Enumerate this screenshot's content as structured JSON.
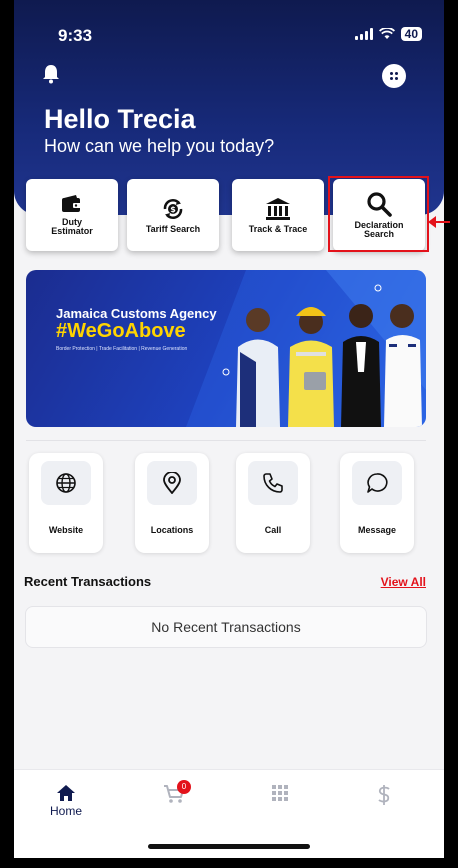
{
  "status_bar": {
    "time": "9:33",
    "battery": "40"
  },
  "header": {
    "greeting": "Hello Trecia",
    "subtitle": "How can we help you today?"
  },
  "quick_actions": [
    {
      "label": "Duty Estimator",
      "icon": "wallet-icon"
    },
    {
      "label": "Tariff Search",
      "icon": "dollar-cycle-icon"
    },
    {
      "label": "Track & Trace",
      "icon": "bank-building-icon"
    },
    {
      "label": "Declaration Search",
      "icon": "search-icon",
      "highlighted": true
    }
  ],
  "banner": {
    "title": "Jamaica Customs Agency",
    "tagline": "#WeGoAbove",
    "subtext": "Border Protection | Trade Facilitation | Revenue Generation"
  },
  "services": [
    {
      "label": "Website",
      "icon": "globe-icon"
    },
    {
      "label": "Locations",
      "icon": "location-pin-icon"
    },
    {
      "label": "Call",
      "icon": "phone-icon"
    },
    {
      "label": "Message",
      "icon": "chat-icon"
    }
  ],
  "recent": {
    "title": "Recent Transactions",
    "view_all": "View All",
    "empty_text": "No Recent Transactions"
  },
  "tabbar": {
    "home_label": "Home",
    "cart_badge": "0"
  },
  "colors": {
    "navy": "#0f1a4f",
    "accent_red": "#e3121b",
    "banner_yellow": "#ffd400"
  }
}
